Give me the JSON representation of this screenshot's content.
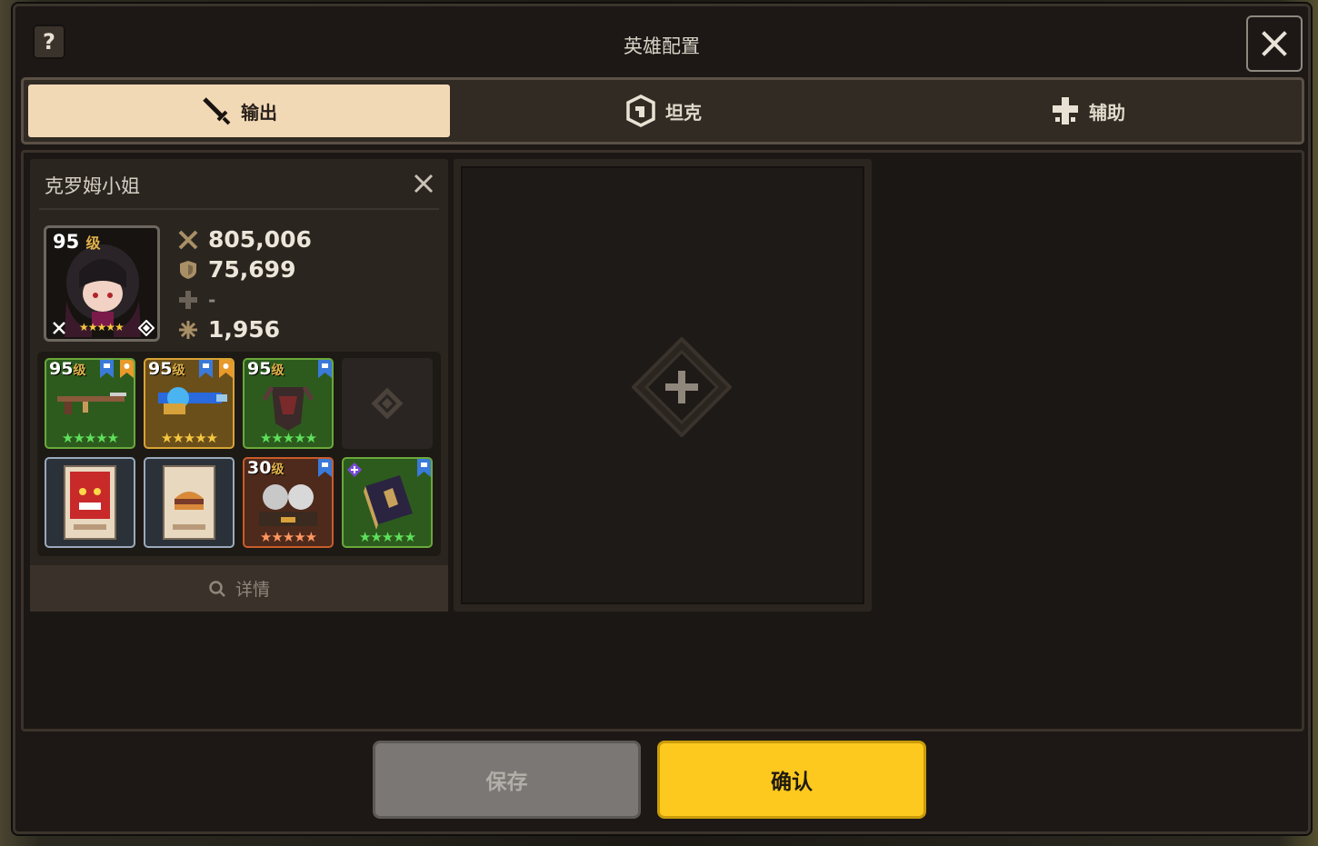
{
  "dialog": {
    "title": "英雄配置",
    "help_label": "?"
  },
  "tabs": [
    {
      "label": "输出",
      "icon": "sword-icon",
      "active": true
    },
    {
      "label": "坦克",
      "icon": "shield-icon",
      "active": false
    },
    {
      "label": "辅助",
      "icon": "support-cross-icon",
      "active": false
    }
  ],
  "hero": {
    "name": "克罗姆小姐",
    "level": "95",
    "level_unit": "级",
    "stars": "★★★★★",
    "stats": {
      "attack": "805,006",
      "defense": "75,699",
      "heal": "-",
      "support": "1,956"
    },
    "equipment": [
      {
        "level": "95",
        "unit": "级",
        "rarity": "green",
        "stars": "★★★★★",
        "item": "rifle"
      },
      {
        "level": "95",
        "unit": "级",
        "rarity": "gold",
        "stars": "★★★★★",
        "item": "blaster"
      },
      {
        "level": "95",
        "unit": "级",
        "rarity": "green",
        "stars": "★★★★★",
        "item": "armor"
      },
      {
        "level": "",
        "unit": "",
        "rarity": "grey",
        "stars": "",
        "item": "empty"
      },
      {
        "level": "",
        "unit": "",
        "rarity": "blue",
        "stars": "",
        "item": "demon-card"
      },
      {
        "level": "",
        "unit": "",
        "rarity": "blue",
        "stars": "",
        "item": "burger-card"
      },
      {
        "level": "30",
        "unit": "级",
        "rarity": "orange",
        "stars": "★★★★★",
        "item": "twin-figures"
      },
      {
        "level": "",
        "unit": "",
        "rarity": "green",
        "stars": "★★★★★",
        "item": "spellbook"
      }
    ],
    "details_label": "详情"
  },
  "buttons": {
    "save": "保存",
    "confirm": "确认"
  },
  "colors": {
    "active_tab": "#f2d9b6",
    "confirm": "#fdc91e",
    "save": "#7a7774"
  }
}
